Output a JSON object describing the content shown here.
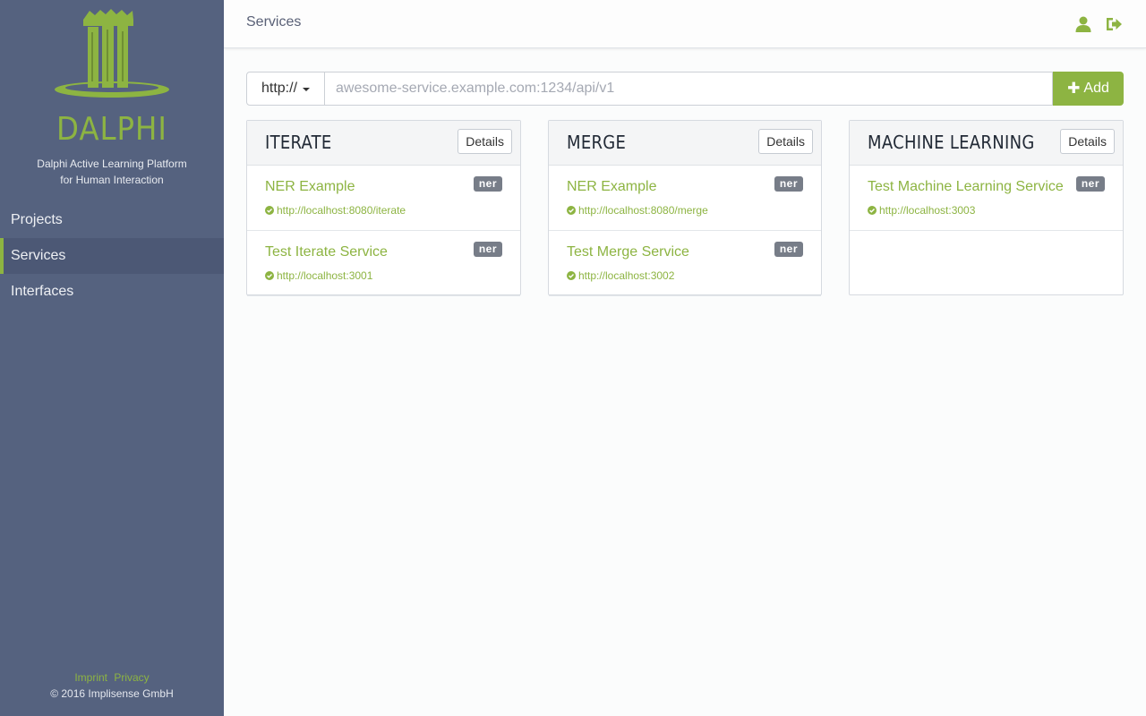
{
  "sidebar": {
    "brand": "DALPHI",
    "tagline_line1": "Dalphi Active Learning Platform",
    "tagline_line2": "for Human Interaction",
    "nav": [
      {
        "label": "Projects"
      },
      {
        "label": "Services"
      },
      {
        "label": "Interfaces"
      }
    ],
    "active_nav": "Services",
    "footer": {
      "imprint": "Imprint",
      "privacy": "Privacy",
      "copyright": "© 2016 Implisense GmbH"
    }
  },
  "header": {
    "title": "Services",
    "icons": [
      "user-icon",
      "sign-out-icon"
    ]
  },
  "addbar": {
    "scheme": "http://",
    "placeholder": "awesome-service.example.com:1234/api/v1",
    "value": "",
    "add_label": "Add"
  },
  "panels": [
    {
      "title": "ITERATE",
      "details_label": "Details",
      "items": [
        {
          "name": "NER Example",
          "badge": "ner",
          "url": "http://localhost:8080/iterate"
        },
        {
          "name": "Test Iterate Service",
          "badge": "ner",
          "url": "http://localhost:3001"
        }
      ]
    },
    {
      "title": "MERGE",
      "details_label": "Details",
      "items": [
        {
          "name": "NER Example",
          "badge": "ner",
          "url": "http://localhost:8080/merge"
        },
        {
          "name": "Test Merge Service",
          "badge": "ner",
          "url": "http://localhost:3002"
        }
      ]
    },
    {
      "title": "MACHINE LEARNING",
      "details_label": "Details",
      "items": [
        {
          "name": "Test Machine Learning Service",
          "badge": "ner",
          "url": "http://localhost:3003"
        }
      ]
    }
  ],
  "colors": {
    "accent": "#8db442",
    "sidebar_bg": "#55627f",
    "badge_bg": "#777d88"
  }
}
